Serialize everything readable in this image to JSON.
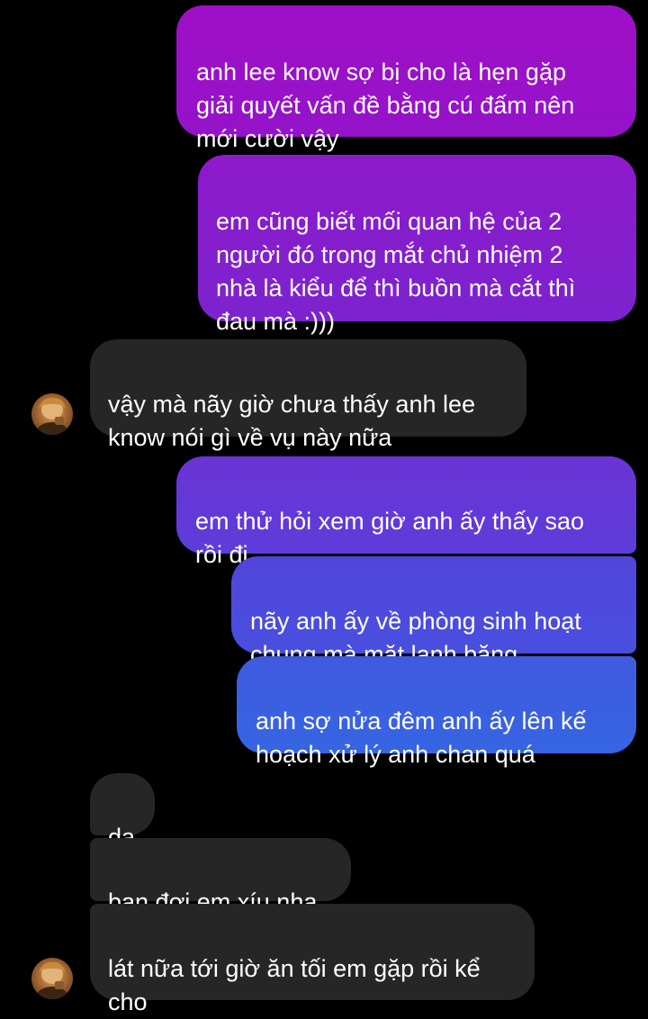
{
  "theme": {
    "background": "#000000",
    "incoming_bubble": "#262626",
    "outgoing_gradient_top": "#a010c8",
    "outgoing_gradient_bottom": "#3565e0"
  },
  "messages": [
    {
      "direction": "outgoing",
      "text": "anh lee know sợ bị cho là hẹn gặp\ngiải quyết vấn đề bằng cú đấm nên\nmới cười vậy"
    },
    {
      "direction": "outgoing",
      "text": "em cũng biết mối quan hệ của 2\nngười đó trong mắt chủ nhiệm 2\nnhà là kiểu để thì buồn mà cắt thì\nđau mà :)))"
    },
    {
      "direction": "incoming",
      "text": "vậy mà nãy giờ chưa thấy anh lee\nknow nói gì về vụ này nữa"
    },
    {
      "direction": "outgoing",
      "text": "em thử hỏi xem giờ anh ấy thấy sao\nrồi đi"
    },
    {
      "direction": "outgoing",
      "text": "nãy anh ấy về phòng sinh hoạt\nchung mà mặt lạnh băng"
    },
    {
      "direction": "outgoing",
      "text": "anh sợ nửa đêm anh ấy lên kế\nhoạch xử lý anh chan quá"
    },
    {
      "direction": "incoming",
      "text": "dạ"
    },
    {
      "direction": "incoming",
      "text": "bạn đợi em xíu nha"
    },
    {
      "direction": "incoming",
      "text": "lát nữa tới giờ ăn tối em gặp rồi kể\ncho"
    }
  ],
  "avatar_icon": "contact-avatar-photo"
}
